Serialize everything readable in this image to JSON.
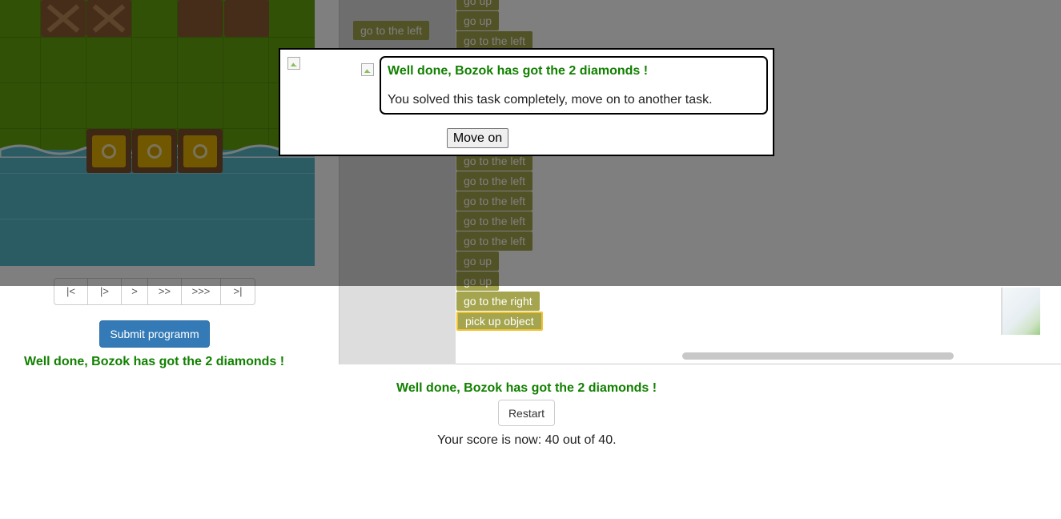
{
  "board": {
    "colors": {
      "grass": "#62a30d",
      "water": "#57b9c9",
      "crate": "#8a5a33",
      "diamond": "#e3b100"
    }
  },
  "controls": {
    "buttons": [
      "|<",
      "|>",
      ">",
      ">>",
      ">>>",
      ">|"
    ]
  },
  "submit_label": "Submit programm",
  "success_message": "Well done, Bozok has got the 2 diamonds !",
  "workspace": {
    "loose_block": "go to the left",
    "program": [
      "go up",
      "go up",
      "go to the left",
      "go to the left",
      "go to the left",
      "go to the left",
      "go to the left",
      "go to the left",
      "go up",
      "go up",
      "go to the right",
      "pick up object"
    ],
    "block_color": "#a5a54f",
    "selected_outline": "#f2c230"
  },
  "popup": {
    "title": "Well done, Bozok has got the 2 diamonds !",
    "text": "You solved this task completely, move on to another task.",
    "button": "Move on"
  },
  "restart_label": "Restart",
  "score_text": "Your score is now: 40 out of 40."
}
